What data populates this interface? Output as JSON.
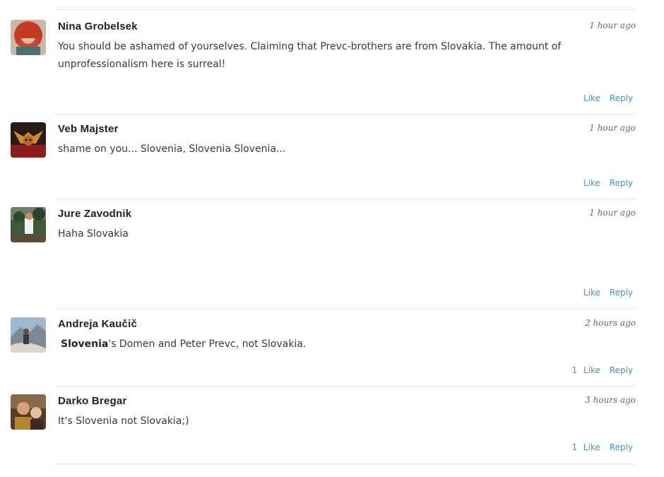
{
  "comments": [
    {
      "author": "Nina Grobelsek",
      "time": "1 hour ago",
      "text": "You should be ashamed of yourselves. Claiming that Prevc-brothers are from Slovakia. The amount of unprofessionalism here is surreal!",
      "like_label": "Like",
      "reply_label": "Reply"
    },
    {
      "author": "Veb Majster",
      "time": "1 hour ago",
      "text": "shame on you... Slovenia, Slovenia Slovenia...",
      "like_label": "Like",
      "reply_label": "Reply"
    },
    {
      "author": "Jure Zavodnik",
      "time": "1 hour ago",
      "text": "Haha Slovakia",
      "like_label": "Like",
      "reply_label": "Reply"
    },
    {
      "author": "Andreja Kaučič",
      "time": "2 hours ago",
      "text_bold": "Slovenia",
      "text_rest": "'s Domen and Peter Prevc, not Slovakia.",
      "like_count": "1",
      "like_label": "Like",
      "reply_label": "Reply"
    },
    {
      "author": "Darko Bregar",
      "time": "3 hours ago",
      "text": "It's Slovenia not Slovakia;)",
      "like_count": "1",
      "like_label": "Like",
      "reply_label": "Reply"
    }
  ]
}
